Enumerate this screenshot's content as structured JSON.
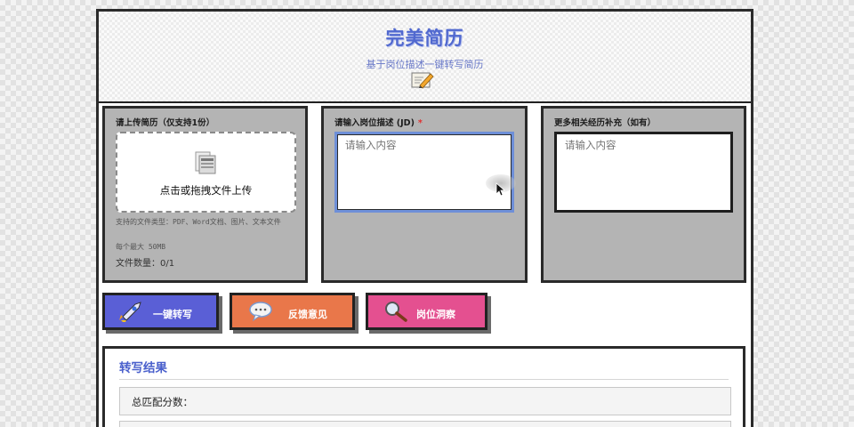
{
  "header": {
    "title": "完美简历",
    "subtitle": "基于岗位描述一键转写简历",
    "icon": "pencil-icon"
  },
  "upload_panel": {
    "label": "请上传简历（仅支持1份）",
    "drop_text": "点击或拖拽文件上传",
    "icon": "file-stack-icon",
    "supported_types": "支持的文件类型：PDF、Word文档、图片、文本文件",
    "max_size": "每个最大 50MB",
    "file_count": "文件数量：0/1"
  },
  "jd_panel": {
    "label": "请输入岗位描述 (JD)",
    "required_mark": "*",
    "placeholder": "请输入内容"
  },
  "extra_panel": {
    "label": "更多相关经历补充（如有）",
    "placeholder": "请输入内容"
  },
  "buttons": [
    {
      "label": "一键转写",
      "icon": "rocket-icon",
      "color": "#5a5fd6"
    },
    {
      "label": "反馈意见",
      "icon": "speech-bubble-icon",
      "color": "#e9774a"
    },
    {
      "label": "岗位洞察",
      "icon": "magnifier-icon",
      "color": "#e45090"
    }
  ],
  "result": {
    "title": "转写结果",
    "score_label": "总匹配分数："
  },
  "colors": {
    "accent": "#5068cf",
    "panel_bg": "#b4b4b4",
    "border": "#2a2a2a"
  }
}
